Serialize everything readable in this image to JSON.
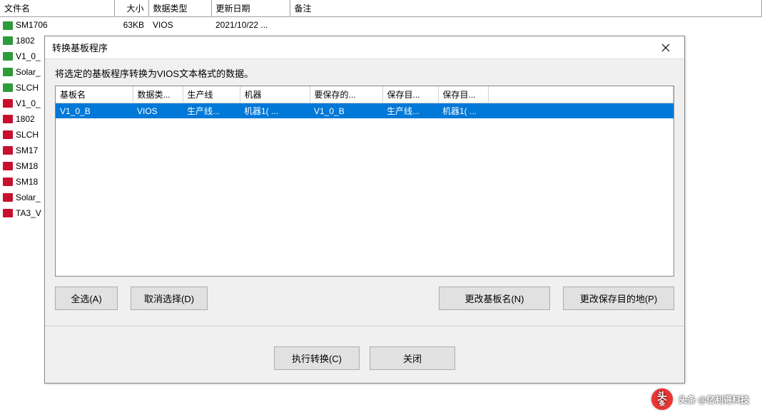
{
  "bg_table": {
    "headers": {
      "name": "文件名",
      "size": "大小",
      "type": "数据类型",
      "date": "更新日期",
      "remark": "备注"
    },
    "rows": [
      {
        "icon": "green",
        "name": "SM1706",
        "size": "63KB",
        "type": "VIOS",
        "date": "2021/10/22 ..."
      },
      {
        "icon": "green",
        "name": "1802",
        "size": "",
        "type": "",
        "date": ""
      },
      {
        "icon": "green",
        "name": "V1_0_",
        "size": "",
        "type": "",
        "date": ""
      },
      {
        "icon": "green",
        "name": "Solar_",
        "size": "",
        "type": "",
        "date": ""
      },
      {
        "icon": "green",
        "name": "SLCH",
        "size": "",
        "type": "",
        "date": ""
      },
      {
        "icon": "red",
        "name": "V1_0_",
        "size": "",
        "type": "",
        "date": ""
      },
      {
        "icon": "red",
        "name": "1802",
        "size": "",
        "type": "",
        "date": ""
      },
      {
        "icon": "red",
        "name": "SLCH",
        "size": "",
        "type": "",
        "date": ""
      },
      {
        "icon": "red",
        "name": "SM17",
        "size": "",
        "type": "",
        "date": ""
      },
      {
        "icon": "red",
        "name": "SM18",
        "size": "",
        "type": "",
        "date": ""
      },
      {
        "icon": "red",
        "name": "SM18",
        "size": "",
        "type": "",
        "date": ""
      },
      {
        "icon": "red",
        "name": "Solar_",
        "size": "",
        "type": "",
        "date": ""
      },
      {
        "icon": "red",
        "name": "TA3_V",
        "size": "",
        "type": "",
        "date": ""
      }
    ]
  },
  "dialog": {
    "title": "转换基板程序",
    "desc": "将选定的基板程序转换为VIOS文本格式的数据。",
    "headers": {
      "c1": "基板名",
      "c2": "数据类...",
      "c3": "生产线",
      "c4": "机器",
      "c5": "要保存的...",
      "c6": "保存目...",
      "c7": "保存目..."
    },
    "rows": [
      {
        "c1": "V1_0_B",
        "c2": "VIOS",
        "c3": "生产线...",
        "c4": "机器1( ...",
        "c5": "V1_0_B",
        "c6": "生产线...",
        "c7": "机器1( ..."
      }
    ],
    "buttons": {
      "select_all": "全选(A)",
      "deselect": "取消选择(D)",
      "change_name": "更改基板名(N)",
      "change_dest": "更改保存目的地(P)",
      "execute": "执行转换(C)",
      "close": "关闭"
    }
  },
  "watermark": "头条 @亿利得科技"
}
